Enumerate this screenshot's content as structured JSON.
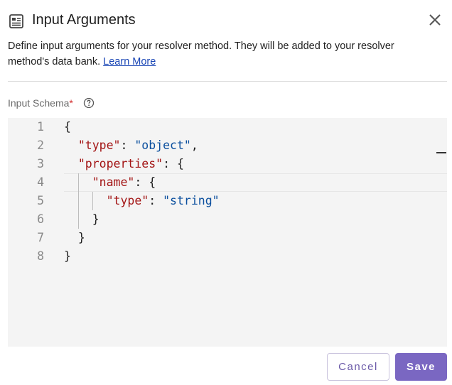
{
  "dialog": {
    "title": "Input Arguments",
    "title_icon": "document-list-icon",
    "close_icon": "close-icon",
    "description": "Define input arguments for your resolver method. They will be added to your resolver method's data bank.",
    "learn_more_label": "Learn More"
  },
  "field": {
    "label": "Input Schema",
    "required_marker": "*",
    "help_icon": "help-circle-icon"
  },
  "editor": {
    "lines": [
      {
        "num": "1",
        "tokens": [
          {
            "t": "{",
            "c": "p"
          }
        ]
      },
      {
        "num": "2",
        "tokens": [
          {
            "t": "  ",
            "c": "p"
          },
          {
            "t": "\"type\"",
            "c": "k"
          },
          {
            "t": ": ",
            "c": "p"
          },
          {
            "t": "\"object\"",
            "c": "s"
          },
          {
            "t": ",",
            "c": "p"
          }
        ]
      },
      {
        "num": "3",
        "tokens": [
          {
            "t": "  ",
            "c": "p"
          },
          {
            "t": "\"properties\"",
            "c": "k"
          },
          {
            "t": ": {",
            "c": "p"
          }
        ]
      },
      {
        "num": "4",
        "tokens": [
          {
            "t": "    ",
            "c": "p"
          },
          {
            "t": "\"name\"",
            "c": "k"
          },
          {
            "t": ": {",
            "c": "p"
          }
        ]
      },
      {
        "num": "5",
        "tokens": [
          {
            "t": "      ",
            "c": "p"
          },
          {
            "t": "\"type\"",
            "c": "k"
          },
          {
            "t": ": ",
            "c": "p"
          },
          {
            "t": "\"string\"",
            "c": "s"
          }
        ]
      },
      {
        "num": "6",
        "tokens": [
          {
            "t": "    }",
            "c": "p"
          }
        ]
      },
      {
        "num": "7",
        "tokens": [
          {
            "t": "  }",
            "c": "p"
          }
        ]
      },
      {
        "num": "8",
        "tokens": [
          {
            "t": "}",
            "c": "p"
          }
        ]
      }
    ]
  },
  "actions": {
    "cancel_label": "Cancel",
    "save_label": "Save"
  },
  "colors": {
    "accent": "#7a67c2",
    "link": "#1a46b5",
    "json_key": "#a31515",
    "json_string": "#0b4f9e"
  }
}
